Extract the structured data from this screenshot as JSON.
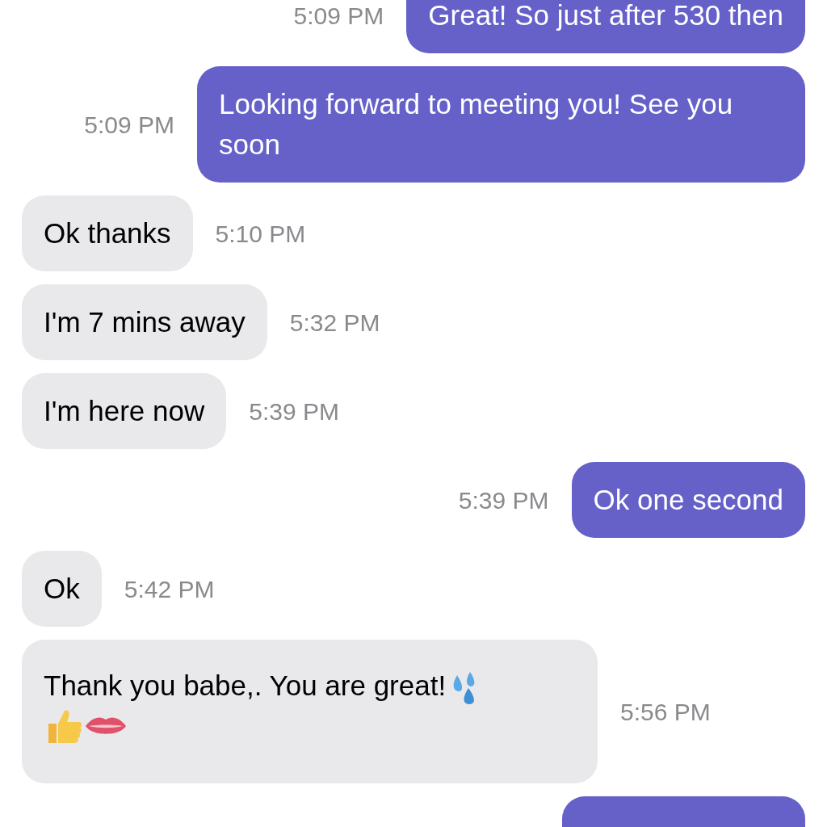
{
  "messages": [
    {
      "kind": "sent",
      "text": "Great! So just after 530 then",
      "time": "5:09 PM"
    },
    {
      "kind": "sent",
      "text": "Looking forward to meeting you! See you soon",
      "time": "5:09 PM"
    },
    {
      "kind": "received",
      "text": "Ok thanks",
      "time": "5:10 PM"
    },
    {
      "kind": "received",
      "text": "I'm 7 mins away",
      "time": "5:32 PM"
    },
    {
      "kind": "received",
      "text": "I'm here now",
      "time": "5:39 PM"
    },
    {
      "kind": "sent",
      "text": "Ok one second",
      "time": "5:39 PM"
    },
    {
      "kind": "received",
      "text": "Ok",
      "time": "5:42 PM"
    },
    {
      "kind": "received",
      "text": "Thank you babe,.  You are great!",
      "emoji_inline": [
        {
          "kind": "droplets"
        }
      ],
      "emoji_line": [
        {
          "kind": "thumbs-up"
        },
        {
          "kind": "lips"
        }
      ],
      "time": "5:56 PM"
    },
    {
      "kind": "sent-cut"
    }
  ]
}
